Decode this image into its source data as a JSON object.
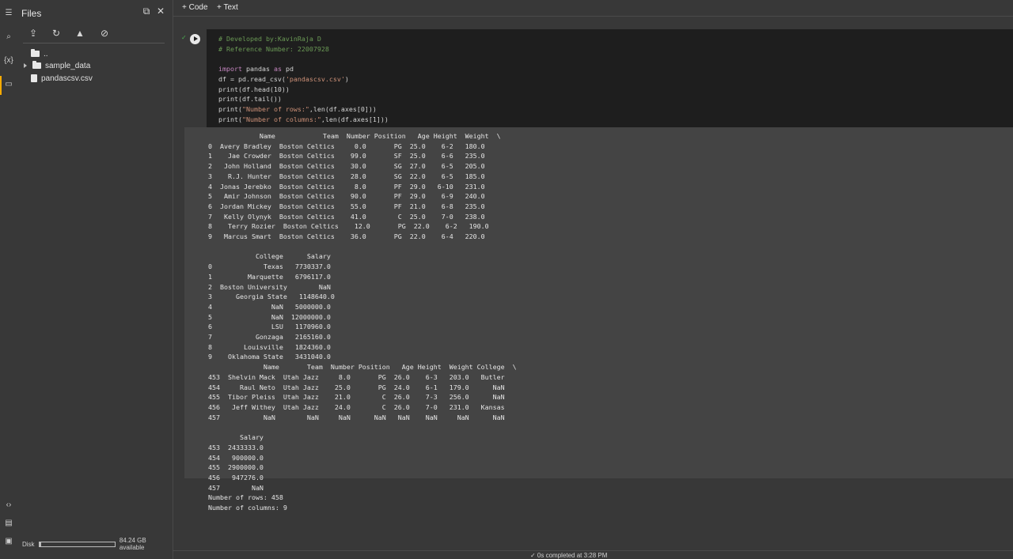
{
  "sidebar_rail": {
    "icons": [
      "menu-icon",
      "search-icon",
      "variables-icon",
      "folder-icon",
      "code-snippets-icon",
      "command-palette-icon",
      "terminal-icon"
    ],
    "variables_label": "{x}"
  },
  "files_panel": {
    "title": "Files",
    "toolbar_icons": [
      "upload-file-icon",
      "refresh-icon",
      "mount-drive-icon",
      "hide-files-icon"
    ],
    "tree": [
      {
        "label": "..",
        "type": "folder"
      },
      {
        "label": "sample_data",
        "type": "folder"
      },
      {
        "label": "pandascsv.csv",
        "type": "file"
      }
    ],
    "disk_label": "Disk",
    "disk_available": "84.24 GB available",
    "disk_used_fraction": 0.03
  },
  "topbar": {
    "add_code": "+ Code",
    "add_text": "+ Text"
  },
  "cell": {
    "status_check": "✓",
    "code_comment_1": "# Developed by:KavinRaja D",
    "code_comment_2": "# Reference Number: 22007928",
    "code_import_kw": "import",
    "code_import_mod": " pandas ",
    "code_import_as": "as",
    "code_import_alias": " pd",
    "code_read_pre": "df = pd.read_csv(",
    "code_read_str": "'pandascsv.csv'",
    "code_read_post": ")",
    "code_line_head": "print(df.head(10))",
    "code_line_tail": "print(df.tail())",
    "code_rows_pre": "print(",
    "code_rows_str": "\"Number of rows:\"",
    "code_rows_post": ",len(df.axes[0]))",
    "code_cols_pre": "print(",
    "code_cols_str": "\"Number of columns:\"",
    "code_cols_post": ",len(df.axes[1]))",
    "output_lines": [
      "             Name            Team  Number Position   Age Height  Weight  \\",
      "0  Avery Bradley  Boston Celtics     0.0       PG  25.0    6-2   180.0",
      "1    Jae Crowder  Boston Celtics    99.0       SF  25.0    6-6   235.0",
      "2   John Holland  Boston Celtics    30.0       SG  27.0    6-5   205.0",
      "3    R.J. Hunter  Boston Celtics    28.0       SG  22.0    6-5   185.0",
      "4  Jonas Jerebko  Boston Celtics     8.0       PF  29.0   6-10   231.0",
      "5   Amir Johnson  Boston Celtics    90.0       PF  29.0    6-9   240.0",
      "6  Jordan Mickey  Boston Celtics    55.0       PF  21.0    6-8   235.0",
      "7   Kelly Olynyk  Boston Celtics    41.0        C  25.0    7-0   238.0",
      "8    Terry Rozier  Boston Celtics    12.0       PG  22.0    6-2   190.0",
      "9   Marcus Smart  Boston Celtics    36.0       PG  22.0    6-4   220.0",
      "",
      "            College      Salary",
      "0             Texas   7730337.0",
      "1         Marquette   6796117.0",
      "2  Boston University        NaN",
      "3      Georgia State   1148640.0",
      "4               NaN   5000000.0",
      "5               NaN  12000000.0",
      "6               LSU   1170960.0",
      "7           Gonzaga   2165160.0",
      "8        Louisville   1824360.0",
      "9    Oklahoma State   3431040.0",
      "              Name       Team  Number Position   Age Height  Weight College  \\",
      "453  Shelvin Mack  Utah Jazz     8.0       PG  26.0    6-3   203.0   Butler",
      "454     Raul Neto  Utah Jazz    25.0       PG  24.0    6-1   179.0      NaN",
      "455  Tibor Pleiss  Utah Jazz    21.0        C  26.0    7-3   256.0      NaN",
      "456   Jeff Withey  Utah Jazz    24.0        C  26.0    7-0   231.0   Kansas",
      "457           NaN        NaN     NaN      NaN   NaN    NaN     NaN      NaN",
      "",
      "        Salary",
      "453  2433333.0",
      "454   900000.0",
      "455  2900000.0",
      "456   947276.0",
      "457        NaN",
      "Number of rows: 458",
      "Number of columns: 9"
    ]
  },
  "status_bar": {
    "text": "✓  0s    completed at 3:28 PM"
  }
}
